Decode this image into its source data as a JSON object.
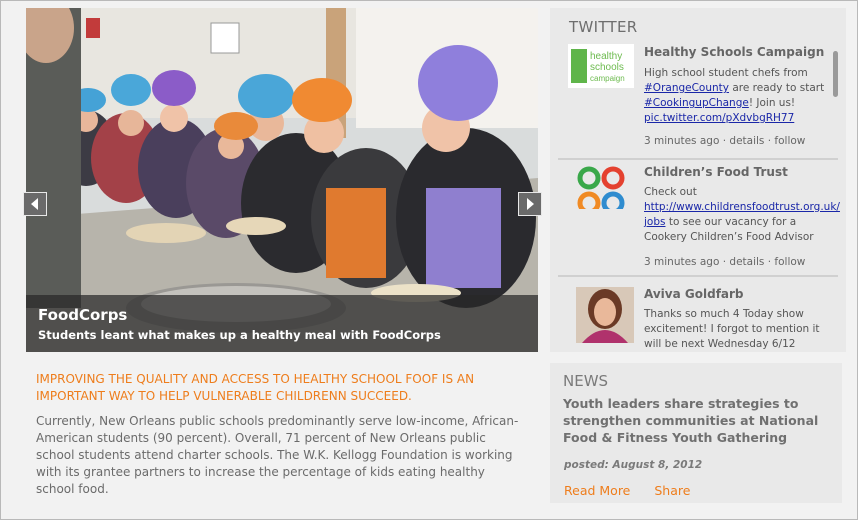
{
  "slideshow": {
    "caption_title": "FoodCorps",
    "caption_subtitle": "Students leant what makes up a healthy meal with FoodCorps"
  },
  "twitter": {
    "heading": "TWITTER",
    "tweets": [
      {
        "name": "Healthy Schools Campaign",
        "avatar_text": [
          "healthy",
          "schools",
          "campaign"
        ],
        "text_before": "High school student  chefs from ",
        "link1": "#OrangeCounty",
        "text_mid": " are ready to start ",
        "link2": "#CookingupChange",
        "text_after": "!  Join us! ",
        "link3": "pic.twitter.com/pXdvbgRH77",
        "time": "3 minutes ago",
        "details": "details",
        "follow": "follow"
      },
      {
        "name": "Children’s Food Trust",
        "text_before": "Check out ",
        "link1": "http://www.childrensfoodtrust.org.uk/jobs",
        "text_after": " to see our vacancy for a Cookery Children’s  Food Advisor",
        "time": "3 minutes ago",
        "details": "details",
        "follow": "follow"
      },
      {
        "name": "Aviva Goldfarb",
        "text": "Thanks so much 4 Today show excitement! I forgot to mention it will be next Wednesday 6/12"
      }
    ],
    "separator": " · "
  },
  "article": {
    "headline": "IMPROVING THE QUALITY AND ACCESS TO HEALTHY SCHOOL FOOF IS AN IMPORTANT WAY TO HELP VULNERABLE CHILDRENN SUCCEED.",
    "body": "Currently, New Orleans public schools predominantly serve low-income, African-American students (90 percent). Overall, 71 percent of New Orleans public school students attend charter schools. The W.K. Kellogg Foundation is working with its grantee partners to increase the percentage of kids eating healthy school food."
  },
  "news": {
    "heading": "NEWS",
    "title": "Youth leaders share strategies to strengthen communities at National Food & Fitness Youth Gathering",
    "posted": "posted: August 8, 2012",
    "read_more": "Read More",
    "share": "Share"
  },
  "colors": {
    "accent_orange": "#ee7d1c",
    "link_blue": "#1a27a8",
    "panel_gray": "#e9e9e9"
  },
  "icons": [
    "chevron-left-icon",
    "chevron-right-icon"
  ]
}
